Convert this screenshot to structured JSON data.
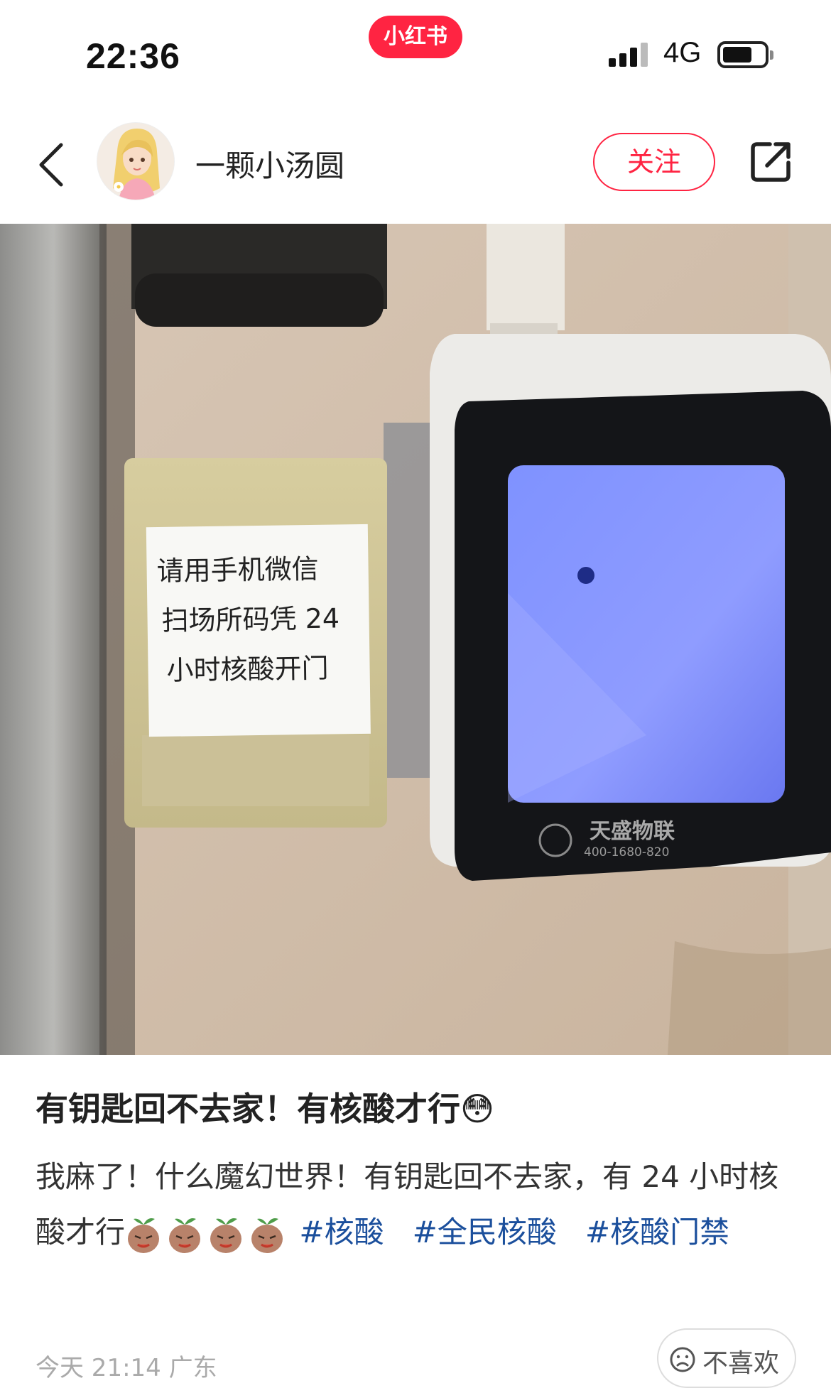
{
  "status_bar": {
    "time": "22:36",
    "app_badge": "小红书",
    "network": "4G",
    "battery_icon": "battery-icon",
    "signal_icon": "signal-icon"
  },
  "header": {
    "back_icon": "chevron-left-icon",
    "username": "一颗小汤圆",
    "follow_label": "关注",
    "share_icon": "share-icon"
  },
  "photo": {
    "sign_lines": [
      "请用手机微信",
      "扫场所码凭 24",
      "小时核酸开门"
    ],
    "device_brand": "天盛物联",
    "device_phone": "400-1680-820"
  },
  "post": {
    "title": "有钥匙回不去家！有核酸才行",
    "title_emoji": "😳",
    "body_text": "我麻了！什么魔幻世界！有钥匙回不去家，有 24 小时核酸才行",
    "emoji_count_shown": 4,
    "tags": [
      "#核酸",
      "#全民核酸",
      "#核酸门禁"
    ],
    "date": "今天 21:14",
    "location": "广东",
    "dislike_label": "不喜欢"
  },
  "colors": {
    "brand": "#ff2442",
    "tag": "#1b4f9c",
    "meta": "#aaaaaa"
  }
}
